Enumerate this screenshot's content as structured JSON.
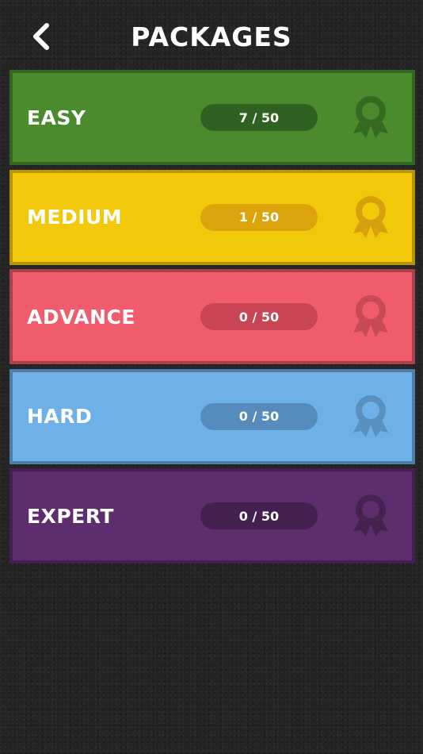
{
  "header": {
    "title": "PACKAGES",
    "back_icon": "chevron-left-icon"
  },
  "packages": [
    {
      "label": "EASY",
      "progress": "7 / 50",
      "completed": 7,
      "total": 50,
      "icon": "award-ribbon-icon",
      "colors": {
        "fill": "#4a8c2d",
        "border": "#35661f",
        "pill": "#2f6120",
        "ribbon": "#356a21"
      }
    },
    {
      "label": "MEDIUM",
      "progress": "1 / 50",
      "completed": 1,
      "total": 50,
      "icon": "award-ribbon-icon",
      "colors": {
        "fill": "#f2c80a",
        "border": "#b8940a",
        "pill": "#dca30c",
        "ribbon": "#d9a00d"
      }
    },
    {
      "label": "ADVANCE",
      "progress": "0 / 50",
      "completed": 0,
      "total": 50,
      "icon": "award-ribbon-icon",
      "colors": {
        "fill": "#f05c6c",
        "border": "#a9404b",
        "pill": "#c94454",
        "ribbon": "#c94a57"
      }
    },
    {
      "label": "HARD",
      "progress": "0 / 50",
      "completed": 0,
      "total": 50,
      "icon": "award-ribbon-icon",
      "colors": {
        "fill": "#6eb0e8",
        "border": "#4f7fa8",
        "pill": "#558cbd",
        "ribbon": "#5890c0"
      }
    },
    {
      "label": "EXPERT",
      "progress": "0 / 50",
      "completed": 0,
      "total": 50,
      "icon": "award-ribbon-icon",
      "colors": {
        "fill": "#5e2d6e",
        "border": "#442050",
        "pill": "#43204f",
        "ribbon": "#452250"
      }
    }
  ]
}
